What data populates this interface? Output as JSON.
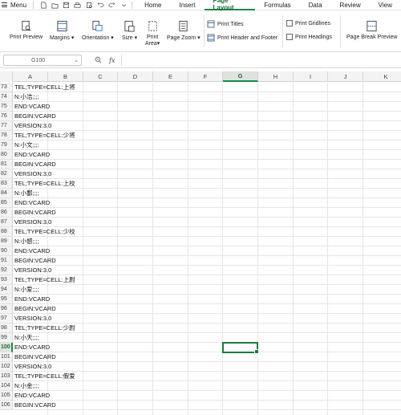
{
  "menubar": {
    "menu_label": "Menu",
    "tabs": [
      "Home",
      "Insert",
      "Page Layout",
      "Formulas",
      "Data",
      "Review",
      "View"
    ],
    "active_tab": "Page Layout"
  },
  "ribbon": {
    "print_preview": "Print Preview",
    "margins": "Margins",
    "orientation": "Orientation",
    "size": "Size",
    "print_area_1": "Print",
    "print_area_2": "Area",
    "page_zoom": "Page Zoom",
    "print_titles": "Print Titles",
    "print_header_footer": "Print Header and Footer",
    "print_gridlines": "Print Gridlines",
    "print_headings": "Print Headings",
    "page_break_preview": "Page Break Preview"
  },
  "formula_bar": {
    "name_box": "G100",
    "fx_label": "fx",
    "content": ""
  },
  "columns": [
    "A",
    "B",
    "C",
    "D",
    "E",
    "F",
    "G",
    "H",
    "I",
    "J",
    "K"
  ],
  "selected_column": "G",
  "selected_row": "100",
  "rows": [
    {
      "num": "73",
      "a": "TEL;TYPE=CELL:上将"
    },
    {
      "num": "74",
      "a": "N:小洁;;;;"
    },
    {
      "num": "75",
      "a": "END:VCARD"
    },
    {
      "num": "76",
      "a": "BEGIN:VCARD"
    },
    {
      "num": "77",
      "a": "VERSION:3.0"
    },
    {
      "num": "78",
      "a": "TEL;TYPE=CELL:少将"
    },
    {
      "num": "79",
      "a": "N:小文;;;;"
    },
    {
      "num": "80",
      "a": "END:VCARD"
    },
    {
      "num": "81",
      "a": "BEGIN:VCARD"
    },
    {
      "num": "82",
      "a": "VERSION:3.0"
    },
    {
      "num": "83",
      "a": "TEL;TYPE=CELL:上校"
    },
    {
      "num": "84",
      "a": "N:小鄱;;;;"
    },
    {
      "num": "85",
      "a": "END:VCARD"
    },
    {
      "num": "86",
      "a": "BEGIN:VCARD"
    },
    {
      "num": "87",
      "a": "VERSION:3.0"
    },
    {
      "num": "88",
      "a": "TEL;TYPE=CELL:少校"
    },
    {
      "num": "89",
      "a": "N:小憾;;;;"
    },
    {
      "num": "90",
      "a": "END:VCARD"
    },
    {
      "num": "91",
      "a": "BEGIN:VCARD"
    },
    {
      "num": "92",
      "a": "VERSION:3.0"
    },
    {
      "num": "93",
      "a": "TEL;TYPE=CELL:上尉"
    },
    {
      "num": "94",
      "a": "N:小爱;;;;"
    },
    {
      "num": "95",
      "a": "END:VCARD"
    },
    {
      "num": "96",
      "a": "BEGIN:VCARD"
    },
    {
      "num": "97",
      "a": "VERSION:3.0"
    },
    {
      "num": "98",
      "a": "TEL;TYPE=CELL:少尉"
    },
    {
      "num": "99",
      "a": "N:小天;;;;"
    },
    {
      "num": "100",
      "a": "END:VCARD"
    },
    {
      "num": "101",
      "a": "BEGIN:VCARD"
    },
    {
      "num": "102",
      "a": "VERSION:3.0"
    },
    {
      "num": "103",
      "a": "TEL;TYPE=CELL:假爱"
    },
    {
      "num": "104",
      "a": "N:小金;;;;"
    },
    {
      "num": "105",
      "a": "END:VCARD"
    },
    {
      "num": "106",
      "a": "BEGIN:VCARD"
    }
  ],
  "colors": {
    "accent": "#1a7a3c",
    "header_bg": "#f3f3f3"
  }
}
